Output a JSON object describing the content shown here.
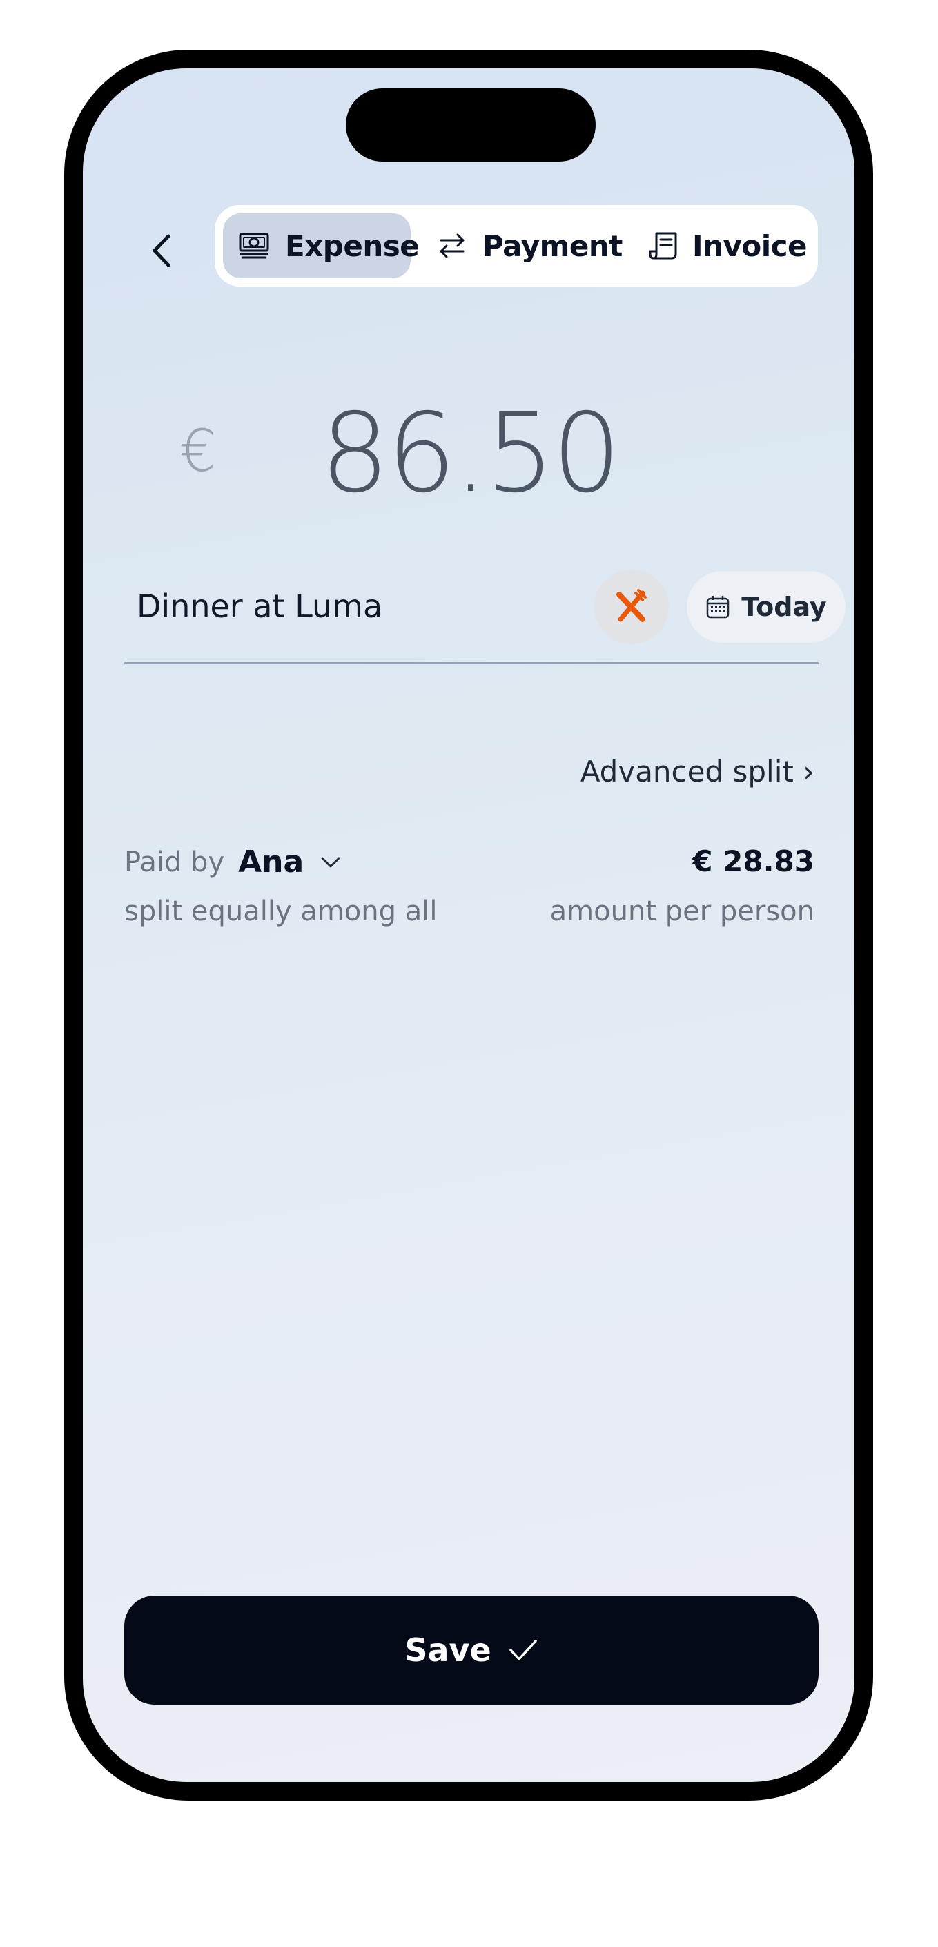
{
  "tabs": [
    {
      "label": "Expense",
      "icon": "banknote-icon",
      "active": true
    },
    {
      "label": "Payment",
      "icon": "arrows-exchange-icon",
      "active": false
    },
    {
      "label": "Invoice",
      "icon": "receipt-icon",
      "active": false
    }
  ],
  "amount": {
    "currency_symbol": "€",
    "value": "86.50"
  },
  "description": {
    "value": "Dinner at Luma"
  },
  "category": {
    "icon": "fork-knife-icon",
    "color": "#e8590c"
  },
  "date": {
    "label": "Today",
    "icon": "calendar-icon"
  },
  "advanced_split": {
    "label": "Advanced split ›"
  },
  "split": {
    "paid_by_label": "Paid by",
    "payer": "Ana",
    "note": "split equally among all",
    "per_person_amount": "€ 28.83",
    "per_person_label": "amount per person"
  },
  "save": {
    "label": "Save",
    "icon": "checkmark-icon"
  },
  "colors": {
    "accent": "#e8590c",
    "primary_button": "#050a18",
    "active_tab": "#cbd5e3"
  }
}
